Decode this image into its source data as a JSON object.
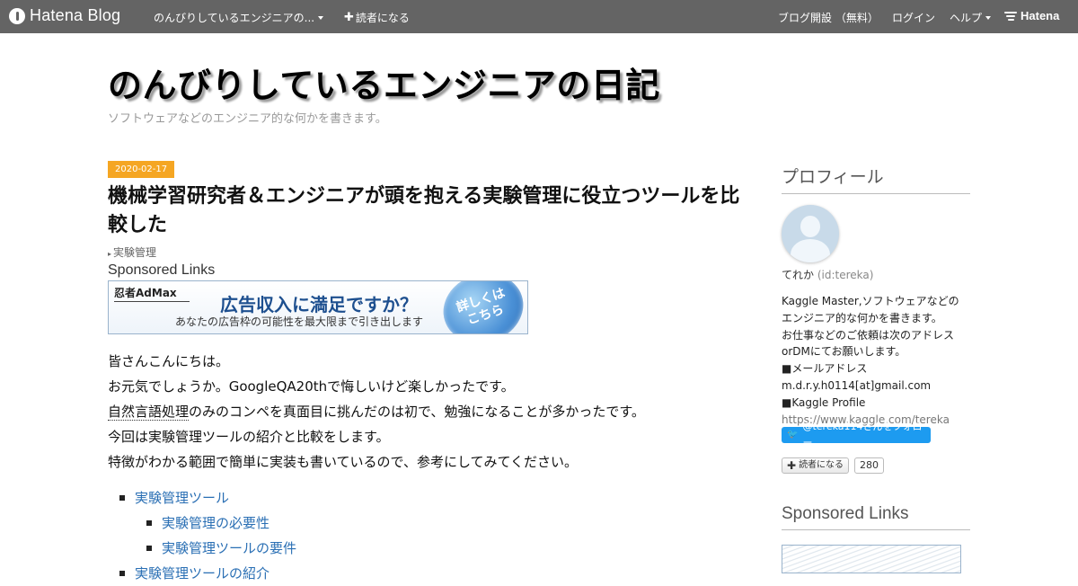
{
  "global_header": {
    "logo_text": "Hatena Blog",
    "blog_menu": "のんびりしているエンジニアの...",
    "subscribe": "読者になる",
    "open_blog": "ブログ開設 （無料）",
    "login": "ログイン",
    "help": "ヘルプ",
    "hatena_logo": "Hatena"
  },
  "blog": {
    "title": "のんびりしているエンジニアの日記",
    "description": "ソフトウェアなどのエンジニア的な何かを書きます。"
  },
  "article": {
    "date": "2020-02-17",
    "title": "機械学習研究者＆エンジニアが頭を抱える実験管理に役立つツールを比較した",
    "category": "実験管理",
    "sponsored_label": "Sponsored Links",
    "ad": {
      "brand": "忍者AdMax",
      "headline": "広告収入に満足ですか？",
      "subline": "あなたの広告枠の可能性を最大限まで引き出します",
      "cta_line1": "詳しくは",
      "cta_line2": "こちら"
    },
    "body": {
      "line1": "皆さんこんにちは。",
      "line2": "お元気でしょうか。GoogleQA20thで悔しいけど楽しかったです。",
      "line3_keyword": "自然言語処理",
      "line3_rest": "のみのコンペを真面目に挑んだのは初で、勉強になることが多かったです。",
      "line4": "今回は実験管理ツールの紹介と比較をします。",
      "line5": "特徴がわかる範囲で簡単に実装も書いているので、参考にしてみてください。"
    },
    "toc": [
      "実験管理ツール",
      "実験管理の必要性",
      "実験管理ツールの要件",
      "実験管理ツールの紹介"
    ]
  },
  "sidebar": {
    "profile_heading": "プロフィール",
    "name": "てれか",
    "user_id": "(id:tereka)",
    "about": [
      "Kaggle Master,ソフトウェアなどの",
      "エンジニア的な何かを書きます。",
      "お仕事などのご依頼は次のアドレス",
      "orDMにてお願いします。",
      "■メールアドレス",
      "m.d.r.y.h0114[at]gmail.com",
      "■Kaggle Profile"
    ],
    "kaggle_link": "https://www.kaggle.com/tereka",
    "twitter_follow": "@tereka114さんをフォロー",
    "subscribe_button": "読者になる",
    "subscriber_count": "280",
    "sponsored_heading": "Sponsored Links"
  },
  "colors": {
    "header_bg": "#646464",
    "date_badge": "#f5a623",
    "link": "#2a6fb4",
    "twitter": "#1d9bf0"
  }
}
